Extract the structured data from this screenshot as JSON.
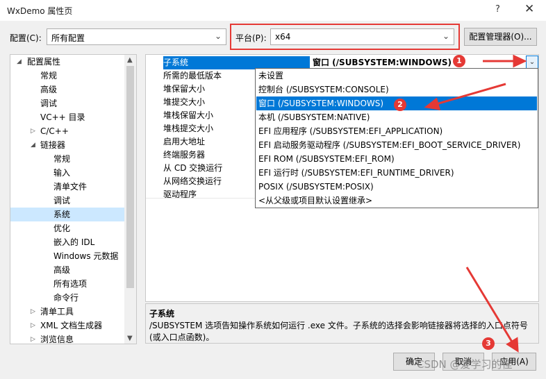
{
  "window": {
    "title": "WxDemo 属性页",
    "help": "?",
    "close": "✕"
  },
  "toolbar": {
    "config_label": "配置(C):",
    "config_value": "所有配置",
    "platform_label": "平台(P):",
    "platform_value": "x64",
    "config_manager_button": "配置管理器(O)..."
  },
  "tree": {
    "items": [
      {
        "label": "配置属性",
        "toggle": "◢"
      },
      {
        "label": "常规"
      },
      {
        "label": "高级"
      },
      {
        "label": "调试"
      },
      {
        "label": "VC++ 目录"
      },
      {
        "label": "C/C++",
        "toggle": "▷"
      },
      {
        "label": "链接器",
        "toggle": "◢"
      },
      {
        "label": "常规"
      },
      {
        "label": "输入"
      },
      {
        "label": "清单文件"
      },
      {
        "label": "调试"
      },
      {
        "label": "系统"
      },
      {
        "label": "优化"
      },
      {
        "label": "嵌入的 IDL"
      },
      {
        "label": "Windows 元数据"
      },
      {
        "label": "高级"
      },
      {
        "label": "所有选项"
      },
      {
        "label": "命令行"
      },
      {
        "label": "清单工具",
        "toggle": "▷"
      },
      {
        "label": "XML 文档生成器",
        "toggle": "▷"
      },
      {
        "label": "浏览信息",
        "toggle": "▷"
      }
    ]
  },
  "properties": {
    "rows": [
      {
        "name": "子系统"
      },
      {
        "name": "所需的最低版本"
      },
      {
        "name": "堆保留大小"
      },
      {
        "name": "堆提交大小"
      },
      {
        "name": "堆栈保留大小"
      },
      {
        "name": "堆栈提交大小"
      },
      {
        "name": "启用大地址"
      },
      {
        "name": "终端服务器"
      },
      {
        "name": "从 CD 交换运行"
      },
      {
        "name": "从网络交换运行"
      },
      {
        "name": "驱动程序"
      }
    ],
    "selected_value": "窗口 (/SUBSYSTEM:WINDOWS)"
  },
  "dropdown": {
    "options": [
      "未设置",
      "控制台 (/SUBSYSTEM:CONSOLE)",
      "窗口 (/SUBSYSTEM:WINDOWS)",
      "本机 (/SUBSYSTEM:NATIVE)",
      "EFI 应用程序 (/SUBSYSTEM:EFI_APPLICATION)",
      "EFI 启动服务驱动程序 (/SUBSYSTEM:EFI_BOOT_SERVICE_DRIVER)",
      "EFI ROM (/SUBSYSTEM:EFI_ROM)",
      "EFI 运行时 (/SUBSYSTEM:EFI_RUNTIME_DRIVER)",
      "POSIX (/SUBSYSTEM:POSIX)",
      "<从父级或项目默认设置继承>"
    ]
  },
  "description": {
    "title": "子系统",
    "text": "/SUBSYSTEM 选项告知操作系统如何运行 .exe 文件。子系统的选择会影响链接器将选择的入口点符号(或入口点函数)。"
  },
  "buttons": {
    "ok": "确定",
    "cancel": "取消",
    "apply": "应用(A)"
  },
  "annotations": {
    "one": "1",
    "two": "2",
    "three": "3",
    "color": "#e53935"
  },
  "watermark": "CSDN @爱学习的佳"
}
